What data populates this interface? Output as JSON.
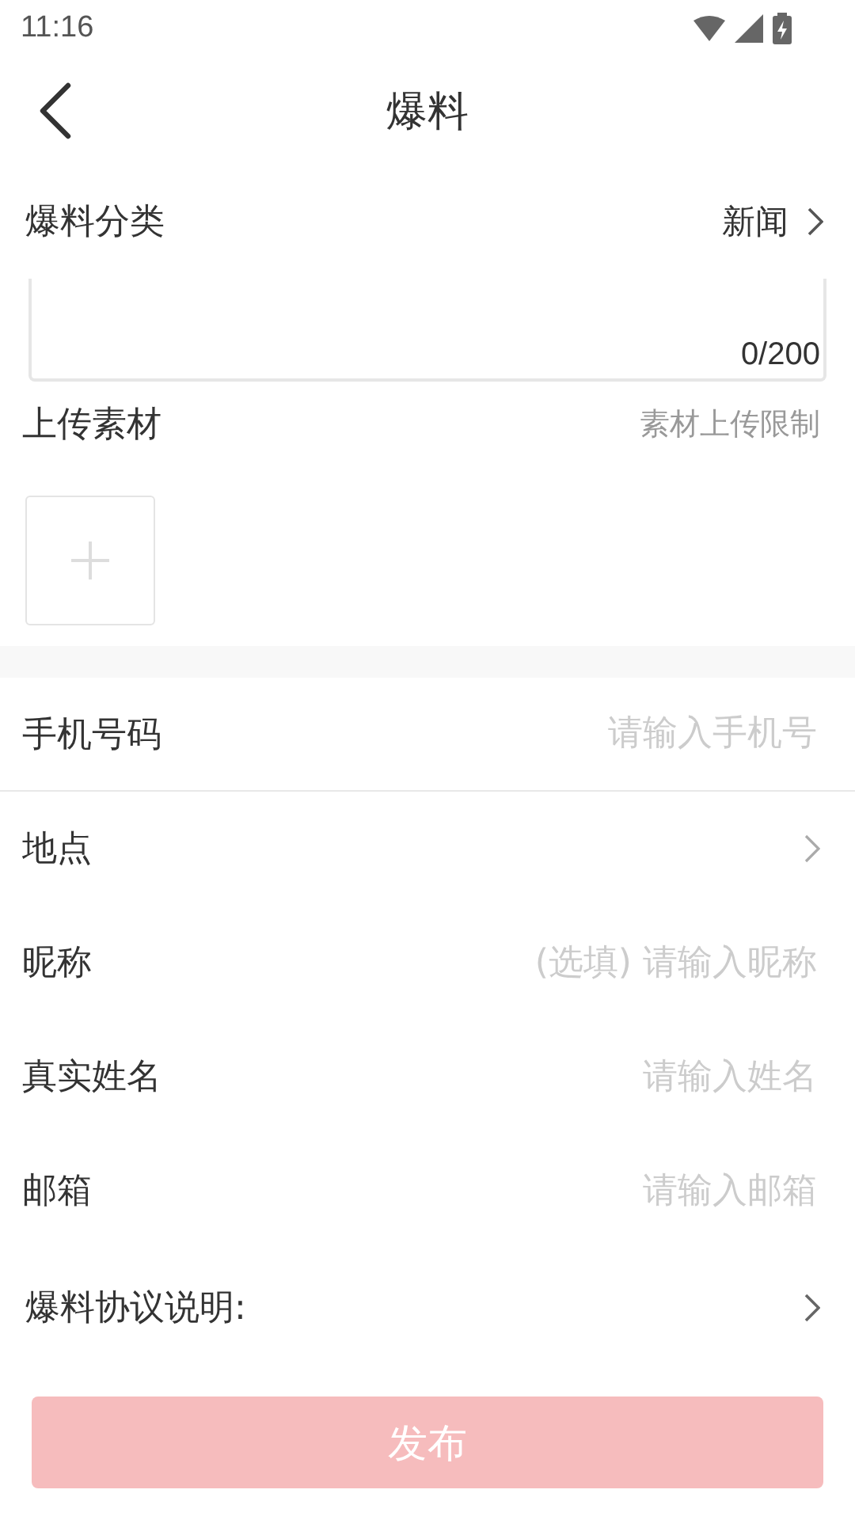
{
  "status_bar": {
    "time": "11:16"
  },
  "header": {
    "title": "爆料"
  },
  "category": {
    "label": "爆料分类",
    "value": "新闻"
  },
  "description": {
    "counter": "0/200"
  },
  "upload": {
    "label": "上传素材",
    "hint": "素材上传限制"
  },
  "fields": [
    {
      "kind": "input",
      "label": "手机号码",
      "placeholder": "请输入手机号",
      "divider": true
    },
    {
      "kind": "select",
      "label": "地点",
      "divider": false
    },
    {
      "kind": "input",
      "label": "昵称",
      "placeholder": "(选填) 请输入昵称",
      "divider": false
    },
    {
      "kind": "input",
      "label": "真实姓名",
      "placeholder": "请输入姓名",
      "divider": false
    },
    {
      "kind": "input",
      "label": "邮箱",
      "placeholder": "请输入邮箱",
      "divider": false
    }
  ],
  "agreement": {
    "label": "爆料协议说明:"
  },
  "submit": {
    "label": "发布",
    "disabled": true
  }
}
